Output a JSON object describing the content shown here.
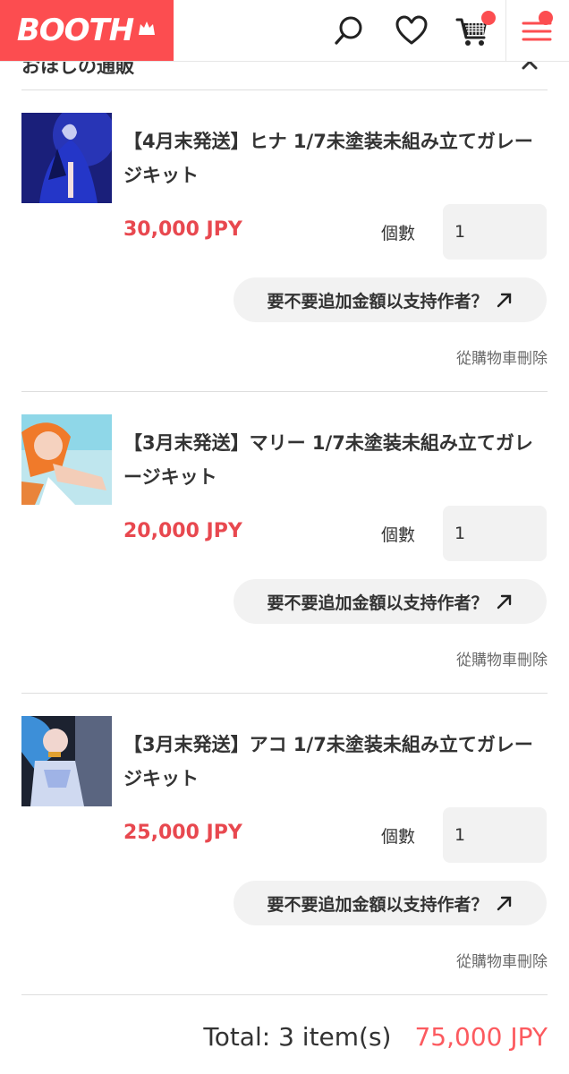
{
  "header": {
    "logo": "BOOTH",
    "icons": [
      "search-icon",
      "heart-icon",
      "cart-icon",
      "menu-icon"
    ],
    "brand_color": "#fc4d50"
  },
  "section": {
    "title": "おほしの通販"
  },
  "items": [
    {
      "title": "【4月末発送】ヒナ 1/7未塗装未組み立てガレージキット",
      "price": "30,000 JPY",
      "qty_label": "個數",
      "qty": "1",
      "support": "要不要追加金額以支持作者？",
      "remove": "從購物車刪除"
    },
    {
      "title": "【3月末発送】マリー 1/7未塗装未組み立てガレージキット",
      "price": "20,000 JPY",
      "qty_label": "個數",
      "qty": "1",
      "support": "要不要追加金額以支持作者？",
      "remove": "從購物車刪除"
    },
    {
      "title": "【3月末発送】アコ 1/7未塗装未組み立てガレージキット",
      "price": "25,000 JPY",
      "qty_label": "個數",
      "qty": "1",
      "support": "要不要追加金額以支持作者？",
      "remove": "從購物車刪除"
    }
  ],
  "total": {
    "label": "Total: 3 item(s)",
    "price": "75,000 JPY"
  }
}
